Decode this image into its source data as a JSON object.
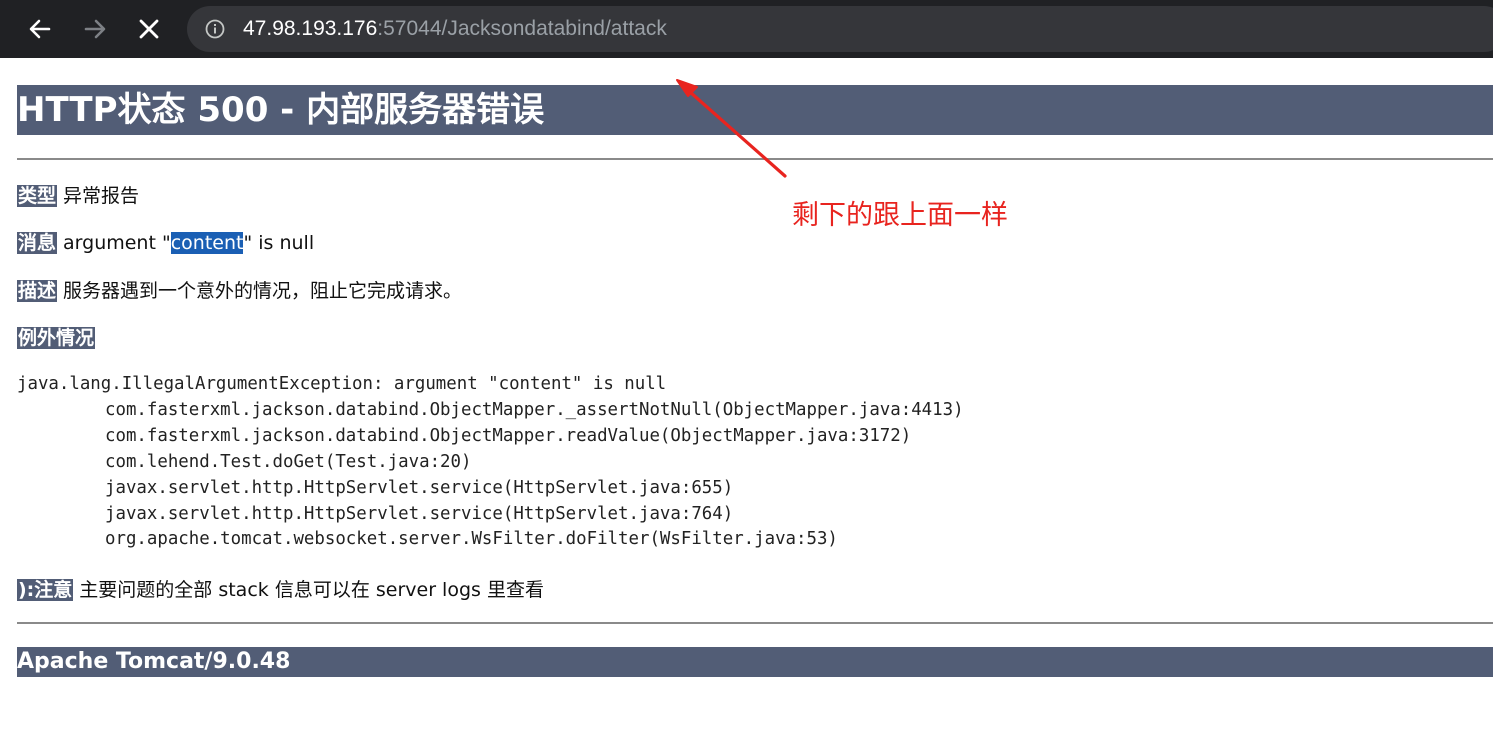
{
  "browser": {
    "url_host": "47.98.193.176",
    "url_rest": ":57044/Jacksondatabind/attack",
    "colors": {
      "chrome": "#202124",
      "omnibox": "#35363a"
    }
  },
  "page": {
    "title": "HTTP状态 500 - 内部服务器错误",
    "type_label": "类型",
    "type_value": "异常报告",
    "message_label": "消息",
    "message_prefix": "argument \"",
    "message_selected": "content",
    "message_suffix": "\" is null",
    "description_label": "描述",
    "description_value": "服务器遇到一个意外的情况，阻止它完成请求。",
    "exception_label": "例外情况",
    "stack_trace": [
      "java.lang.IllegalArgumentException: argument \"content\" is null",
      "com.fasterxml.jackson.databind.ObjectMapper._assertNotNull(ObjectMapper.java:4413)",
      "com.fasterxml.jackson.databind.ObjectMapper.readValue(ObjectMapper.java:3172)",
      "com.lehend.Test.doGet(Test.java:20)",
      "javax.servlet.http.HttpServlet.service(HttpServlet.java:655)",
      "javax.servlet.http.HttpServlet.service(HttpServlet.java:764)",
      "org.apache.tomcat.websocket.server.WsFilter.doFilter(WsFilter.java:53)"
    ],
    "note_label": "):注意",
    "note_value": "主要问题的全部 stack 信息可以在 server logs 里查看",
    "footer": "Apache Tomcat/9.0.48",
    "colors": {
      "header_bar": "#525d76",
      "selection": "#1a5fb4"
    }
  },
  "annotation": {
    "text": "剩下的跟上面一样",
    "color": "#e8241f"
  }
}
